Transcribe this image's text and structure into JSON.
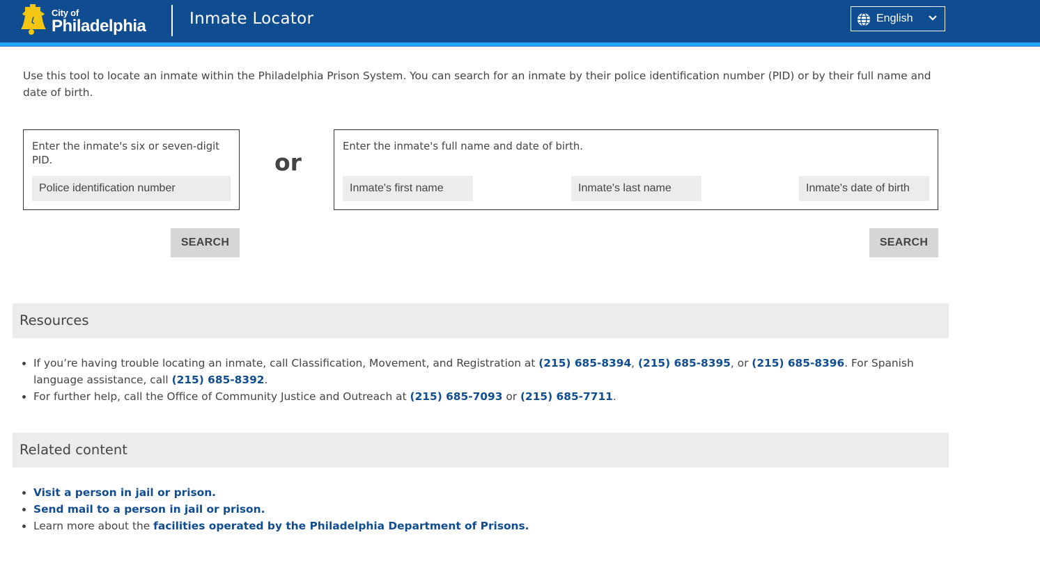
{
  "header": {
    "logo_city": "City of",
    "logo_name": "Philadelphia",
    "app_title": "Inmate Locator",
    "language": "English",
    "icons": {
      "logo": "liberty-bell-icon",
      "language": "globe-icon",
      "dropdown": "chevron-down-icon"
    }
  },
  "intro": "Use this tool to locate an inmate within the Philadelphia Prison System. You can search for an inmate by their police identification number (PID) or by their full name and date of birth.",
  "pid_search": {
    "label": "Enter the inmate's six or seven-digit PID.",
    "placeholder": "Police identification number",
    "button": "SEARCH"
  },
  "or_label": "or",
  "name_search": {
    "label": "Enter the inmate's full name and date of birth.",
    "first_placeholder": "Inmate's first name",
    "last_placeholder": "Inmate's last name",
    "dob_placeholder": "Inmate's date of birth",
    "button": "SEARCH"
  },
  "resources": {
    "title": "Resources",
    "item1": {
      "text1": "If you’re having trouble locating an inmate, call Classification, Movement, and Registration at ",
      "phone1": "(215) 685-8394",
      "sep1": ", ",
      "phone2": "(215) 685-8395",
      "sep2": ", or ",
      "phone3": "(215) 685-8396",
      "text2": ". For Spanish language assistance, call ",
      "phone4": "(215) 685-8392",
      "text3": "."
    },
    "item2": {
      "text1": "For further help, call the Office of Community Justice and Outreach at ",
      "phone1": "(215) 685-7093",
      "sep": " or ",
      "phone2": "(215) 685-7711",
      "text2": "."
    }
  },
  "related": {
    "title": "Related content",
    "link1": "Visit a person in jail or prison.",
    "link2": "Send mail to a person in jail or prison.",
    "item3_text": "Learn more about the ",
    "link3": "facilities operated by the Philadelphia Department of Prisons."
  },
  "colors": {
    "header_bg": "#0f4d90",
    "header_stripe": "#25a6ff",
    "link": "#0f4d90",
    "logo_bell": "#f3c613",
    "section_bg": "#ececec",
    "button_bg": "#d6d6d6",
    "text": "#444444"
  }
}
